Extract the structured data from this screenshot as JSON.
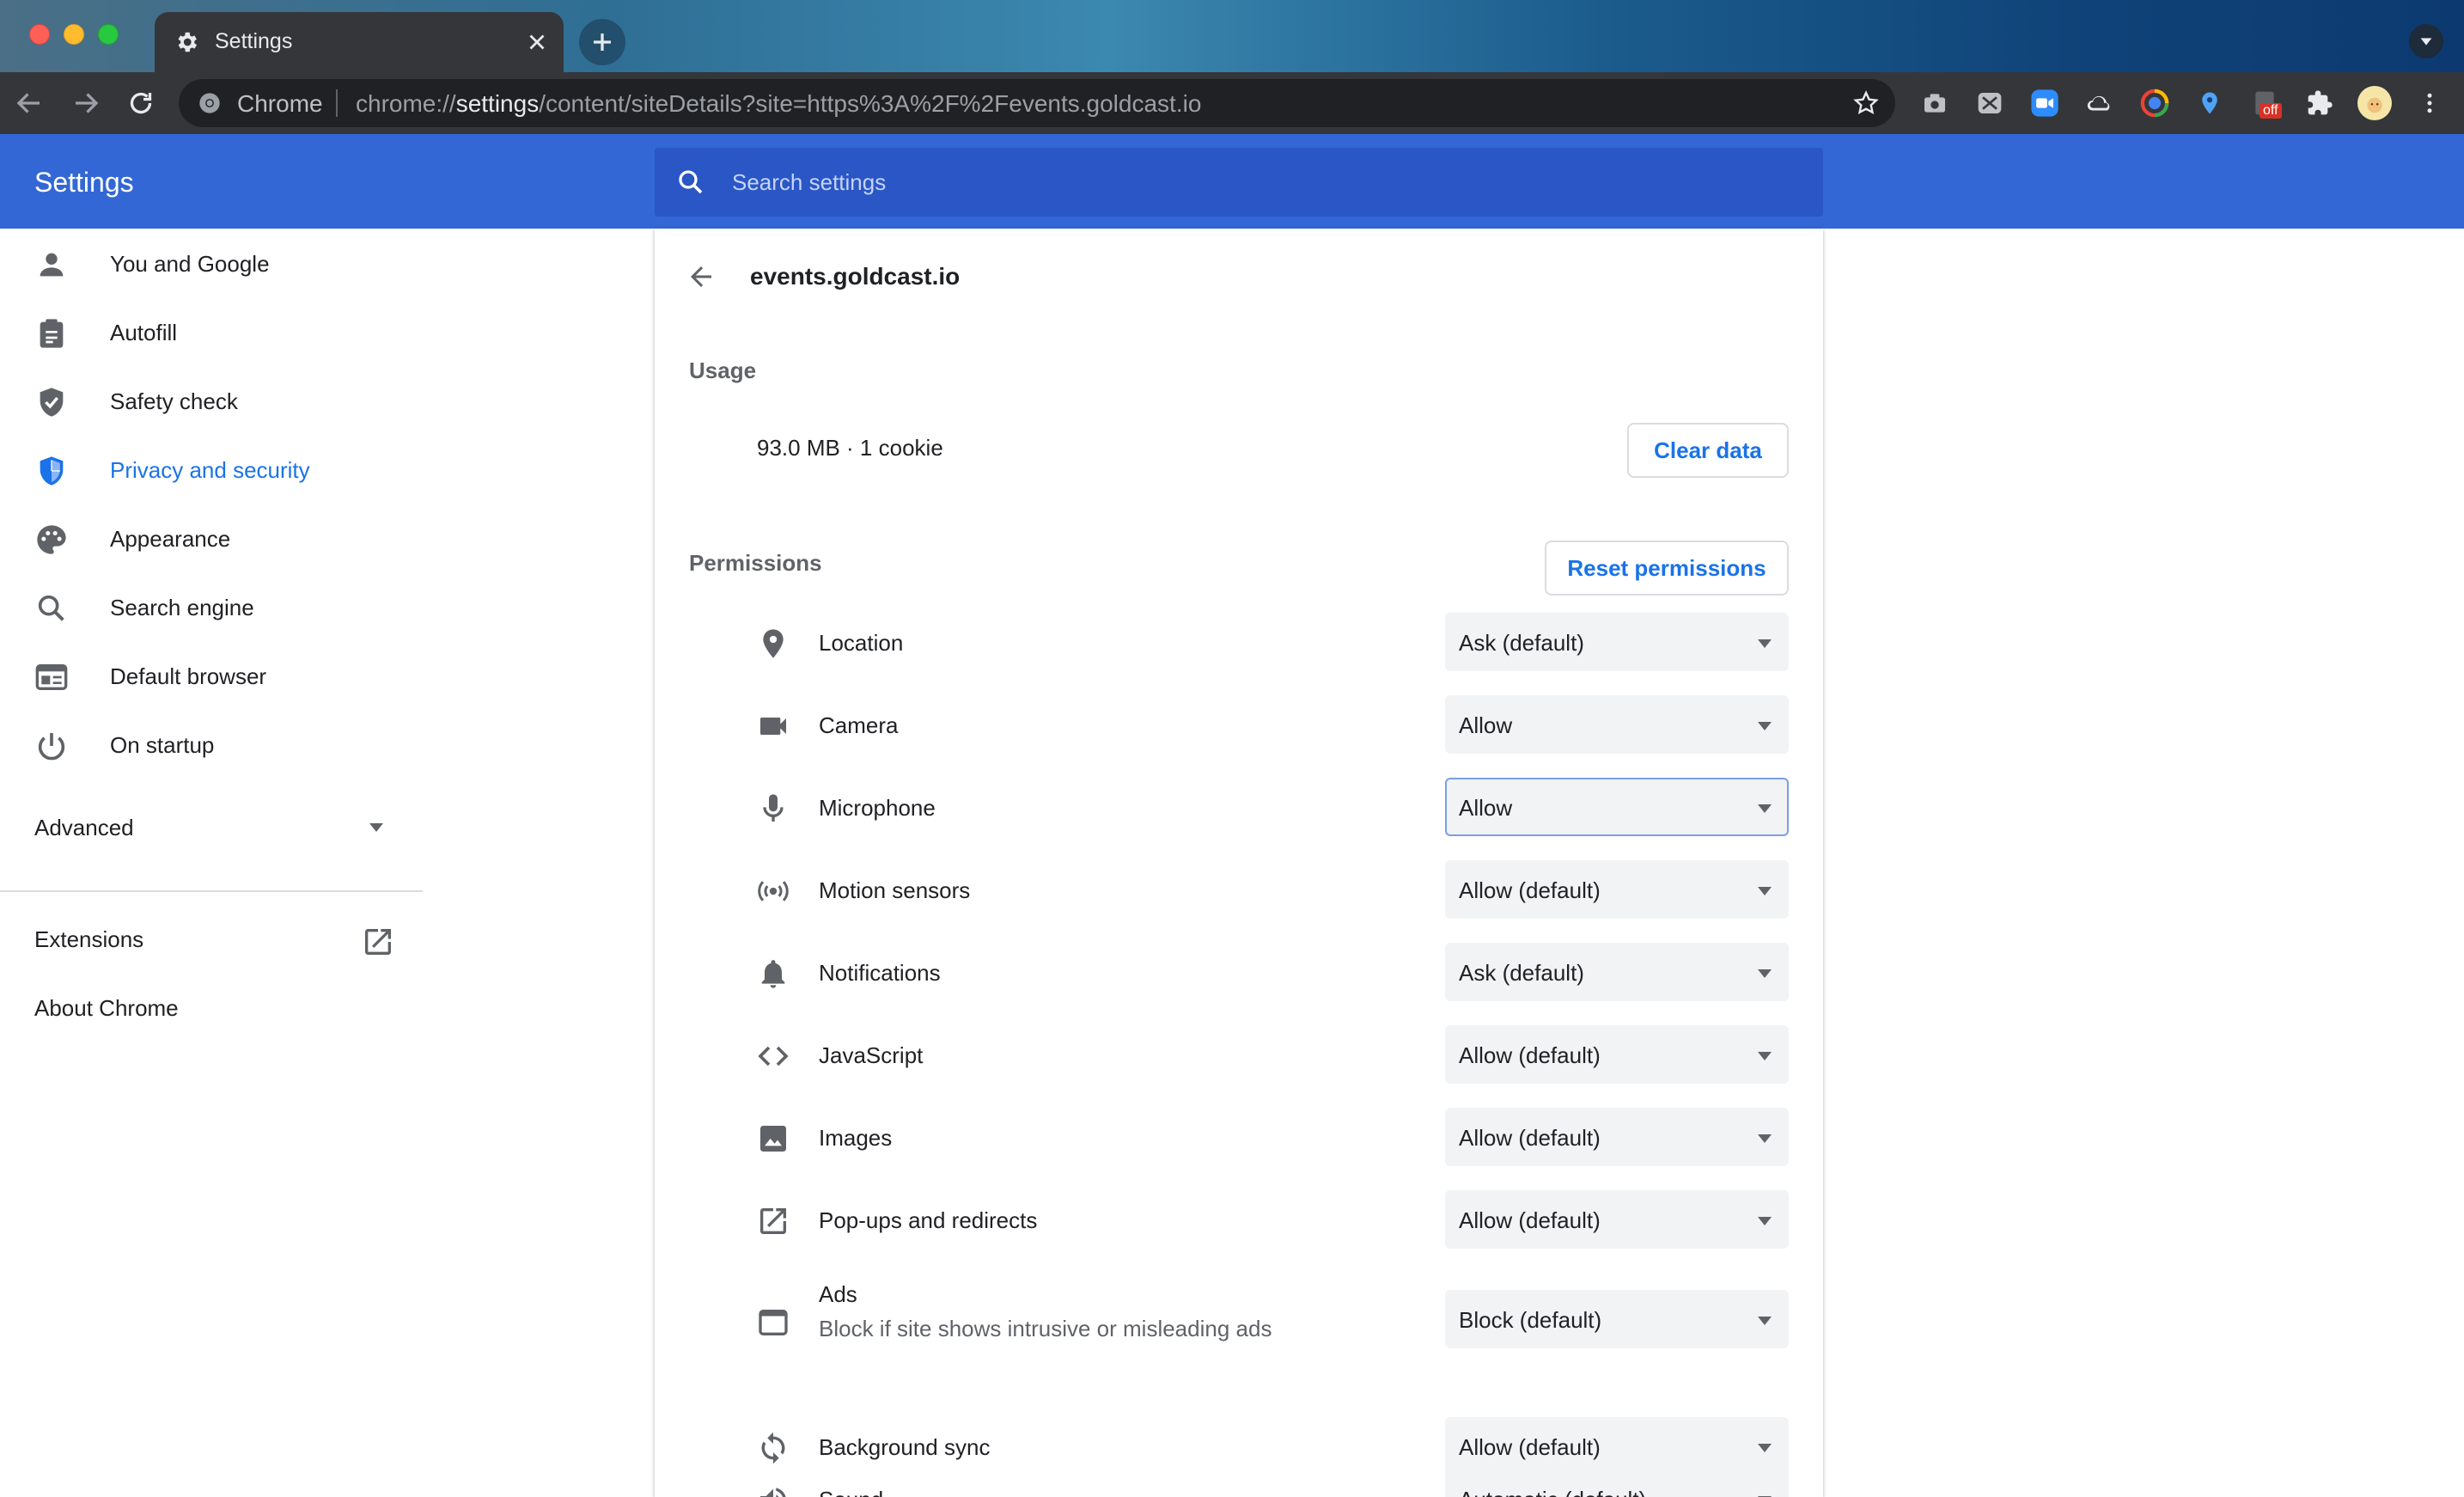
{
  "browser": {
    "tab_title": "Settings",
    "omnibox_label": "Chrome",
    "url_prefix": "chrome://",
    "url_host": "settings",
    "url_rest": "/content/siteDetails?site=https%3A%2F%2Fevents.goldcast.io",
    "extension_badge": "off"
  },
  "header": {
    "title": "Settings",
    "search_placeholder": "Search settings"
  },
  "sidebar": {
    "items": [
      {
        "label": "You and Google",
        "icon": "person-icon"
      },
      {
        "label": "Autofill",
        "icon": "clipboard-icon"
      },
      {
        "label": "Safety check",
        "icon": "shield-check-icon"
      },
      {
        "label": "Privacy and security",
        "icon": "shield-privacy-icon",
        "active": true
      },
      {
        "label": "Appearance",
        "icon": "palette-icon"
      },
      {
        "label": "Search engine",
        "icon": "search-icon"
      },
      {
        "label": "Default browser",
        "icon": "browser-icon"
      },
      {
        "label": "On startup",
        "icon": "power-icon"
      }
    ],
    "advanced": "Advanced",
    "extensions": "Extensions",
    "about": "About Chrome"
  },
  "site": {
    "title": "events.goldcast.io",
    "usage_label": "Usage",
    "usage_text": "93.0 MB · 1 cookie",
    "clear_data": "Clear data",
    "permissions_label": "Permissions",
    "reset_permissions": "Reset permissions",
    "permissions": [
      {
        "label": "Location",
        "value": "Ask (default)",
        "icon": "location-pin-icon"
      },
      {
        "label": "Camera",
        "value": "Allow",
        "icon": "camera-icon"
      },
      {
        "label": "Microphone",
        "value": "Allow",
        "icon": "microphone-icon",
        "focused": true
      },
      {
        "label": "Motion sensors",
        "value": "Allow (default)",
        "icon": "motion-sensor-icon"
      },
      {
        "label": "Notifications",
        "value": "Ask (default)",
        "icon": "bell-icon"
      },
      {
        "label": "JavaScript",
        "value": "Allow (default)",
        "icon": "code-icon"
      },
      {
        "label": "Images",
        "value": "Allow (default)",
        "icon": "image-icon"
      },
      {
        "label": "Pop-ups and redirects",
        "value": "Allow (default)",
        "icon": "open-in-new-icon"
      },
      {
        "label": "Ads",
        "sublabel": "Block if site shows intrusive or misleading ads",
        "value": "Block (default)",
        "icon": "ads-window-icon"
      },
      {
        "label": "Background sync",
        "value": "Allow (default)",
        "icon": "sync-icon"
      },
      {
        "label": "Sound",
        "value": "Automatic (default)",
        "icon": "speaker-icon"
      }
    ]
  },
  "colors": {
    "header_blue": "#3367d6",
    "accent": "#1a73e8"
  }
}
